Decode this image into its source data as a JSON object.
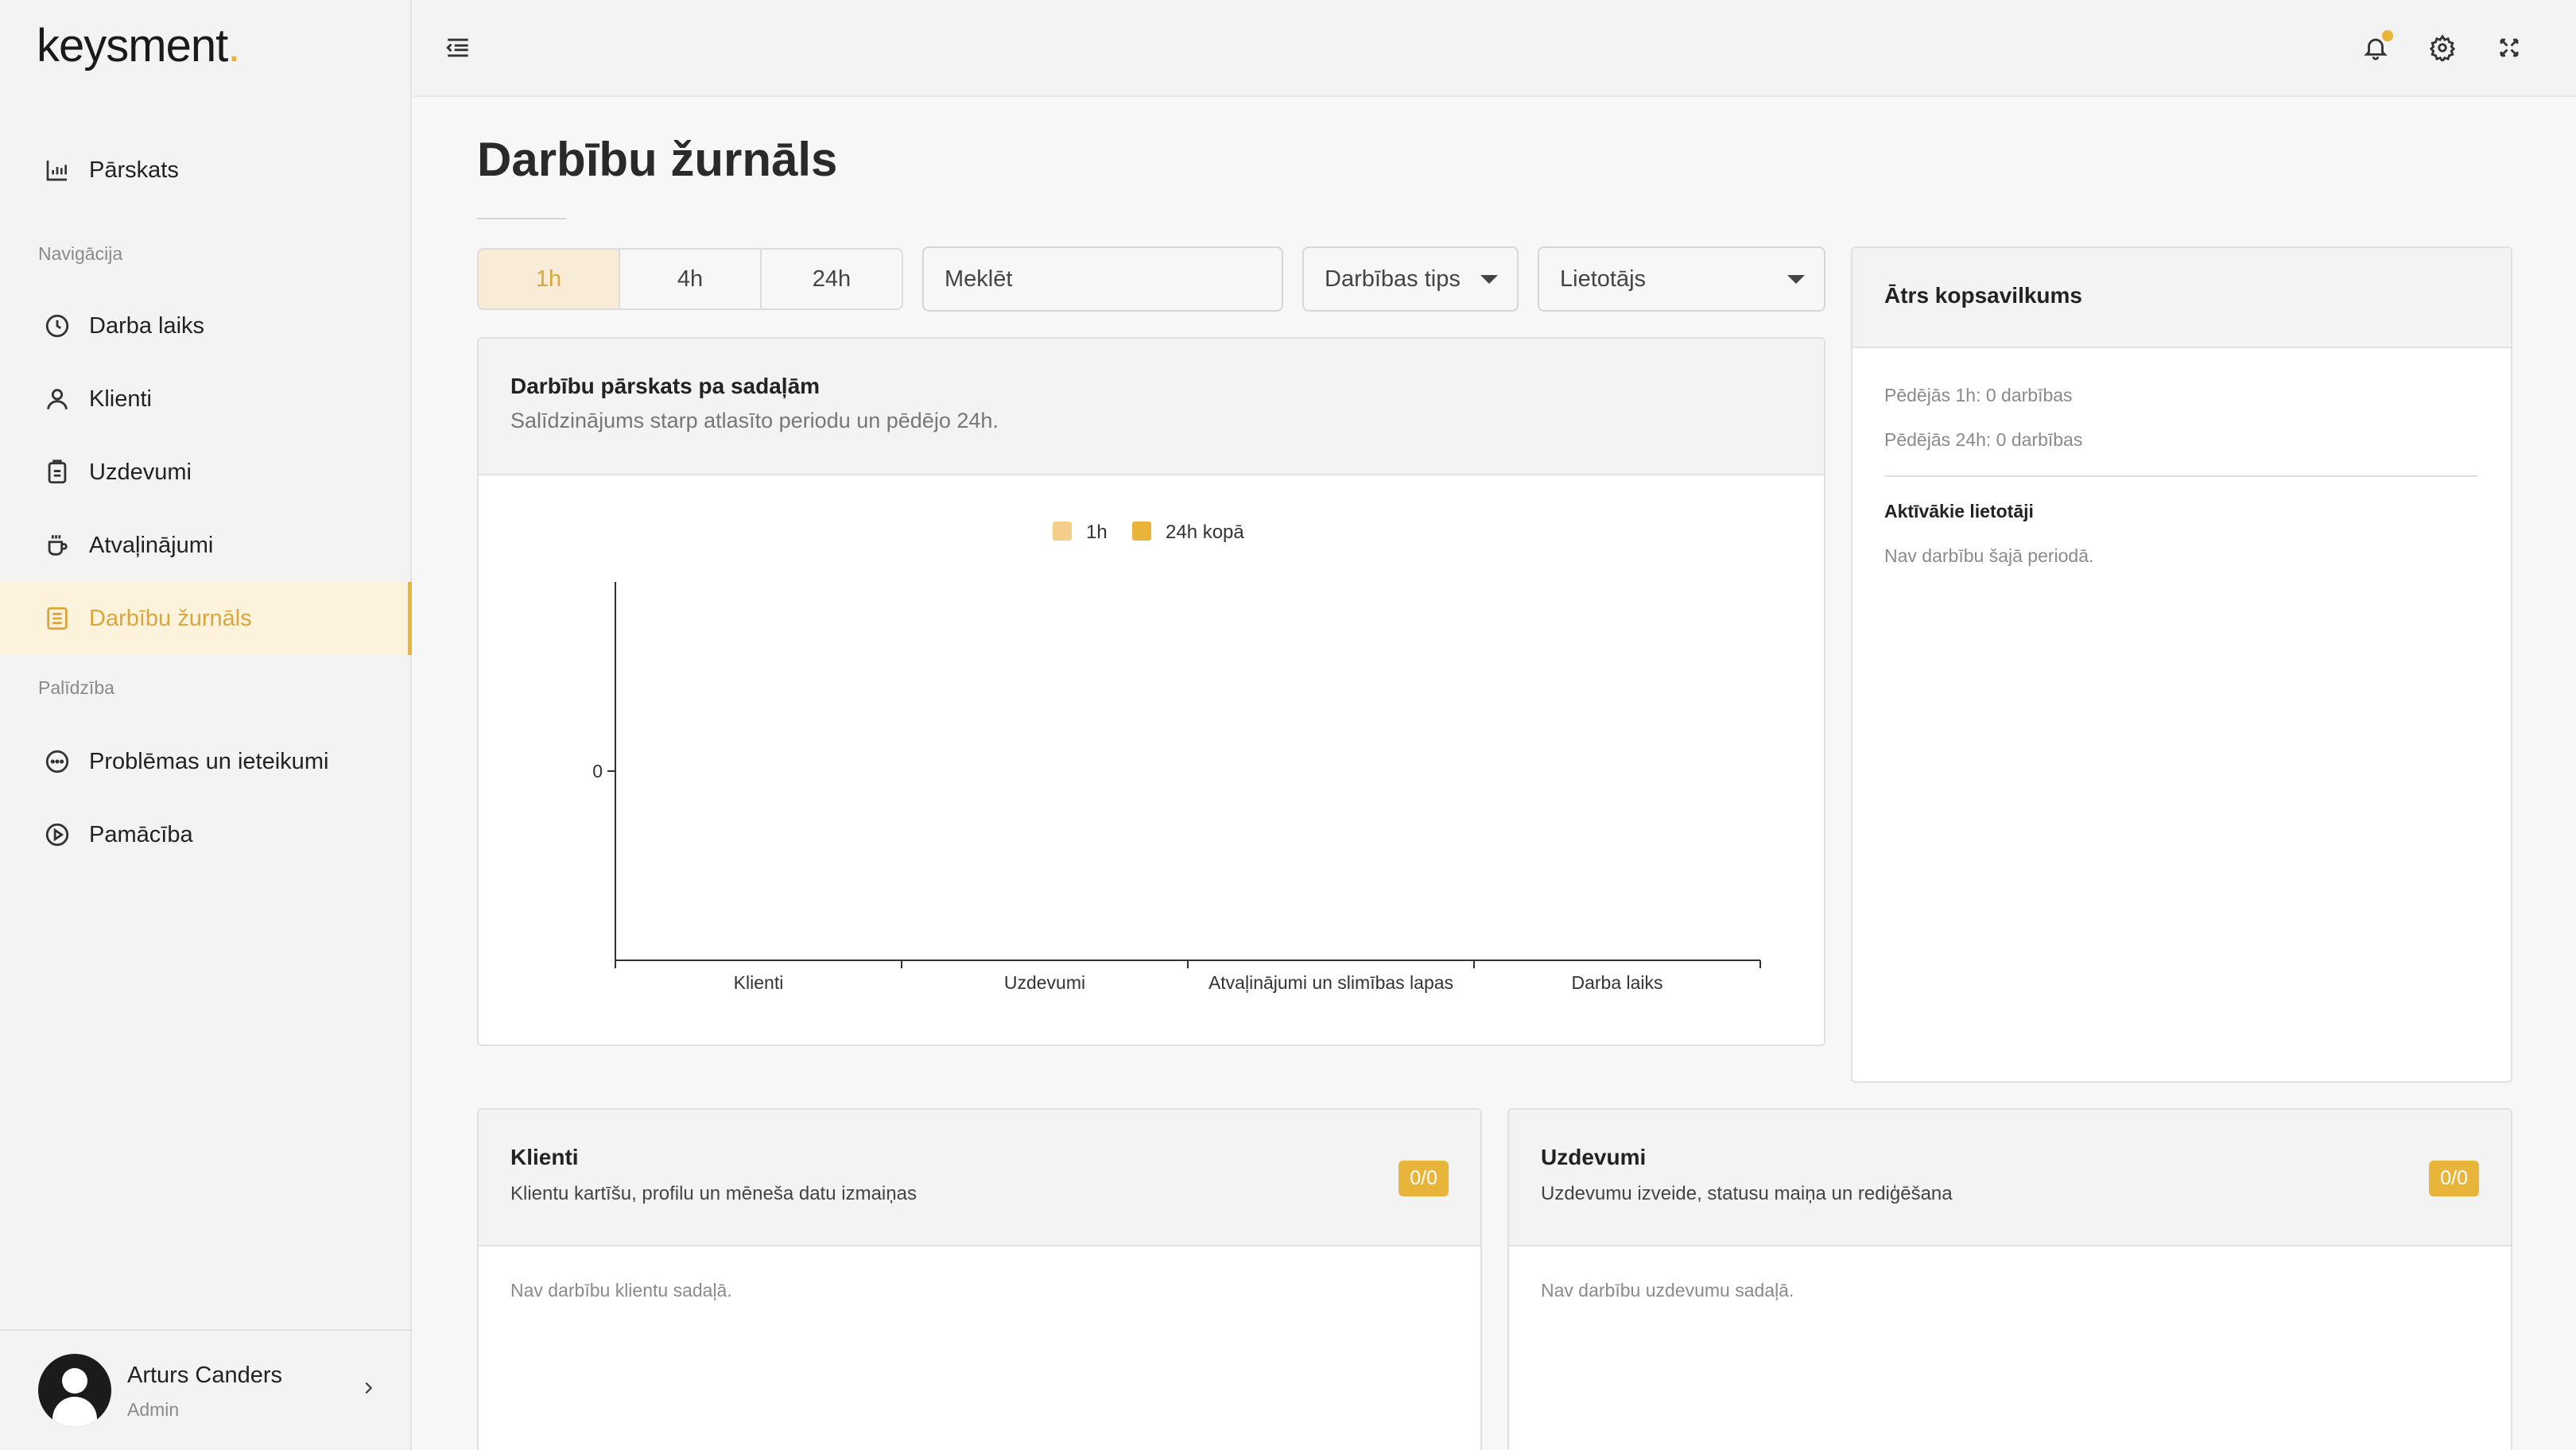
{
  "app": {
    "logo_text": "keysment",
    "logo_dot": ".",
    "brand_color": "#e8b53a"
  },
  "sidebar": {
    "overview_label": "Pārskats",
    "section_navigation": "Navigācija",
    "items": [
      {
        "label": "Darba laiks",
        "icon": "clock-icon"
      },
      {
        "label": "Klienti",
        "icon": "user-icon"
      },
      {
        "label": "Uzdevumi",
        "icon": "clipboard-icon"
      },
      {
        "label": "Atvaļinājumi",
        "icon": "coffee-icon"
      },
      {
        "label": "Darbību žurnāls",
        "icon": "list-icon",
        "active": true
      }
    ],
    "section_help": "Palīdzība",
    "help_items": [
      {
        "label": "Problēmas un ieteikumi",
        "icon": "chat-icon"
      },
      {
        "label": "Pamācība",
        "icon": "play-icon"
      }
    ],
    "user": {
      "name": "Arturs Canders",
      "role": "Admin"
    }
  },
  "page": {
    "title": "Darbību žurnāls"
  },
  "filters": {
    "periods": [
      "1h",
      "4h",
      "24h"
    ],
    "active_period": "1h",
    "search_placeholder": "Meklēt",
    "type_select": "Darbības tips",
    "user_select": "Lietotājs"
  },
  "overview_card": {
    "title": "Darbību pārskats pa sadaļām",
    "subtitle": "Salīdzinājums starp atlasīto periodu un pēdējo 24h."
  },
  "chart_data": {
    "type": "bar",
    "categories": [
      "Klienti",
      "Uzdevumi",
      "Atvaļinājumi un slimības lapas",
      "Darba laiks"
    ],
    "series": [
      {
        "name": "1h",
        "values": [
          0,
          0,
          0,
          0
        ],
        "color": "#f5cf8a"
      },
      {
        "name": "24h kopā",
        "values": [
          0,
          0,
          0,
          0
        ],
        "color": "#e8b53a"
      }
    ],
    "yticks": [
      0
    ],
    "legend": "top-center"
  },
  "summary": {
    "title": "Ātrs kopsavilkums",
    "last_1h": "Pēdējās 1h: 0 darbības",
    "last_24h": "Pēdējās 24h: 0 darbības",
    "active_users_title": "Aktīvākie lietotāji",
    "active_users_empty": "Nav darbību šajā periodā."
  },
  "clients_card": {
    "title": "Klienti",
    "subtitle": "Klientu kartīšu, profilu un mēneša datu izmaiņas",
    "badge": "0/0",
    "empty": "Nav darbību klientu sadaļā."
  },
  "tasks_card": {
    "title": "Uzdevumi",
    "subtitle": "Uzdevumu izveide, statusu maiņa un rediģēšana",
    "badge": "0/0",
    "empty": "Nav darbību uzdevumu sadaļā."
  }
}
